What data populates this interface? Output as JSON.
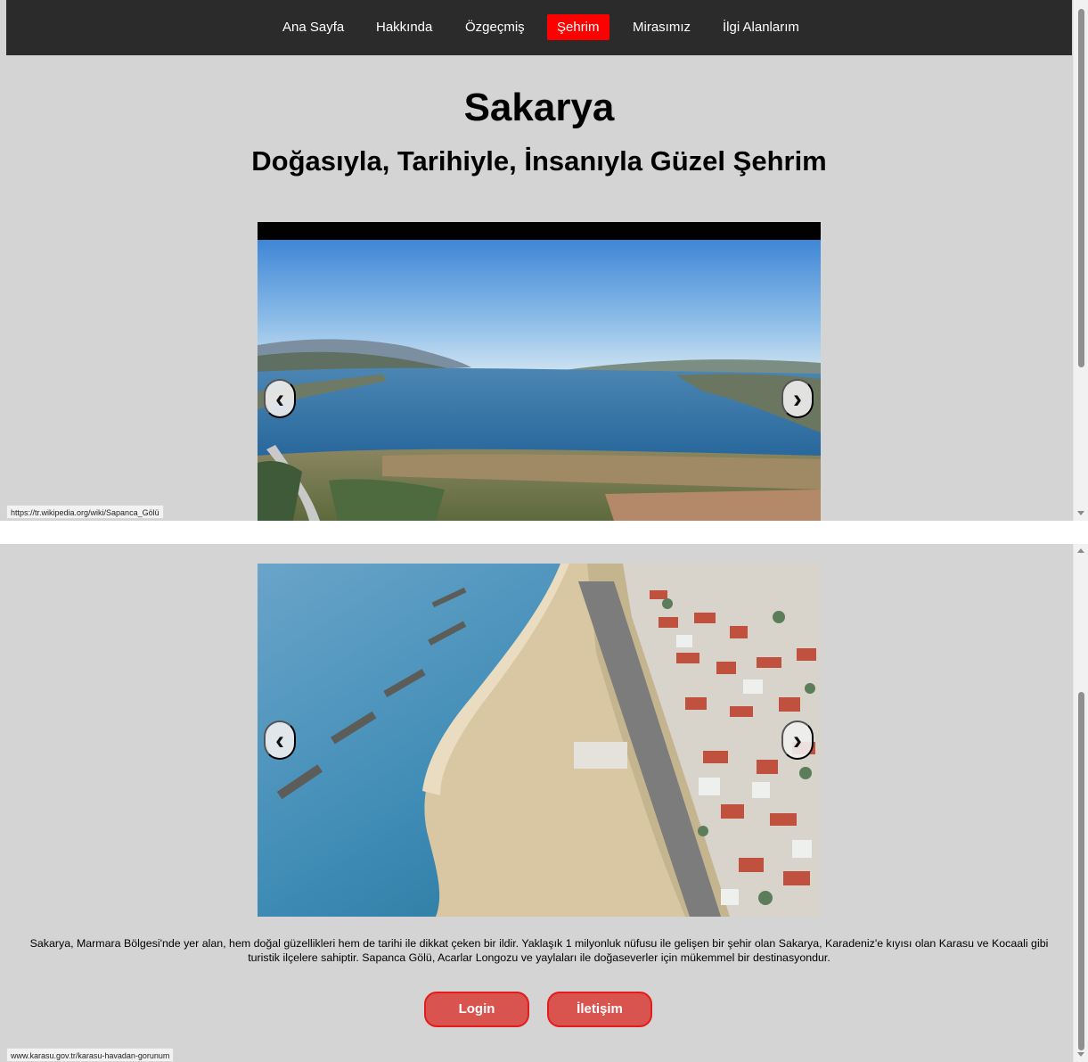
{
  "nav": {
    "items": [
      {
        "label": "Ana Sayfa"
      },
      {
        "label": "Hakkında"
      },
      {
        "label": "Özgeçmiş"
      },
      {
        "label": "Şehrim"
      },
      {
        "label": "Mirasımız"
      },
      {
        "label": "İlgi Alanlarım"
      }
    ],
    "active_index": 3
  },
  "header": {
    "title": "Sakarya",
    "subtitle": "Doğasıyla, Tarihiyle, İnsanıyla Güzel Şehrim"
  },
  "carousel": {
    "prev_icon": "‹",
    "next_icon": "›",
    "slides": [
      {
        "subject": "Sapanca lake aerial view"
      },
      {
        "subject": "Karasu coast aerial view"
      }
    ]
  },
  "status_bar": {
    "top_url": "https://tr.wikipedia.org/wiki/Sapanca_Gölü",
    "bottom_url": "www.karasu.gov.tr/karasu-havadan-gorunum"
  },
  "description": "Sakarya, Marmara Bölgesi'nde yer alan, hem doğal güzellikleri hem de tarihi ile dikkat çeken bir ildir. Yaklaşık 1 milyonluk nüfusu ile gelişen bir şehir olan Sakarya, Karadeniz'e kıyısı olan Karasu ve Kocaali gibi turistik ilçelere sahiptir. Sapanca Gölü, Acarlar Longozu ve yaylaları ile doğaseverler için mükemmel bir destinasyondur.",
  "buttons": {
    "login": "Login",
    "contact": "İletişim"
  },
  "colors": {
    "navbar_bg": "#2b2b2b",
    "active_nav": "#ff0000",
    "page_bg": "#d4d4d4",
    "button_bg": "#d9534f",
    "button_border": "#e31b1b"
  }
}
